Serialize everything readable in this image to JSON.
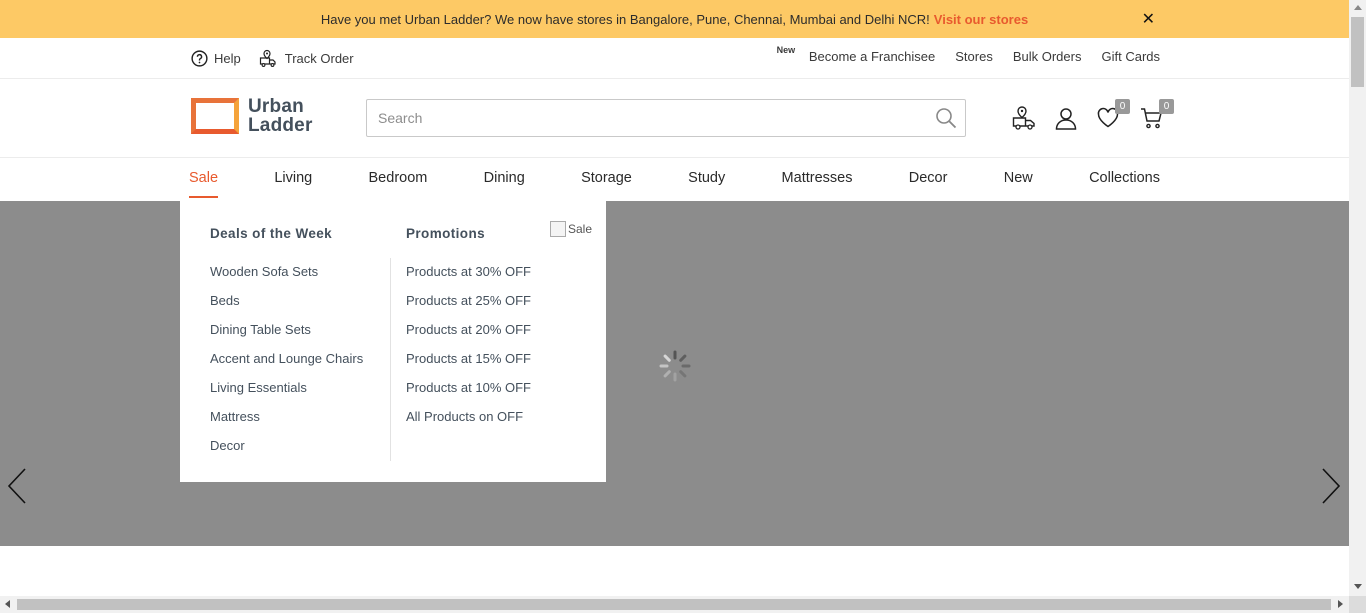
{
  "announcement": {
    "text": "Have you met Urban Ladder? We now have stores in Bangalore, Pune, Chennai, Mumbai and Delhi NCR!",
    "link": "Visit our stores",
    "close": "✕"
  },
  "utility": {
    "help": "Help",
    "track_order": "Track Order",
    "new_badge": "New",
    "right": [
      "Become a Franchisee",
      "Stores",
      "Bulk Orders",
      "Gift Cards"
    ]
  },
  "header": {
    "logo_line1": "Urban",
    "logo_line2": "Ladder",
    "search_placeholder": "Search",
    "wishlist_count": "0",
    "cart_count": "0"
  },
  "nav": {
    "items": [
      "Sale",
      "Living",
      "Bedroom",
      "Dining",
      "Storage",
      "Study",
      "Mattresses",
      "Decor",
      "New",
      "Collections"
    ],
    "active": "Sale"
  },
  "dropdown": {
    "col1_title": "Deals of the Week",
    "col1_items": [
      "Wooden Sofa Sets",
      "Beds",
      "Dining Table Sets",
      "Accent and Lounge Chairs",
      "Living Essentials",
      "Mattress",
      "Decor"
    ],
    "col2_title": "Promotions",
    "col2_items": [
      "Products at 30% OFF",
      "Products at 25% OFF",
      "Products at 20% OFF",
      "Products at 15% OFF",
      "Products at 10% OFF",
      "All Products on OFF"
    ],
    "image_alt": "Sale"
  },
  "colors": {
    "announcement_bg": "#fdc965",
    "accent": "#e85a2e",
    "hero_bg": "#8c8c8c",
    "text_dark": "#44505c"
  }
}
